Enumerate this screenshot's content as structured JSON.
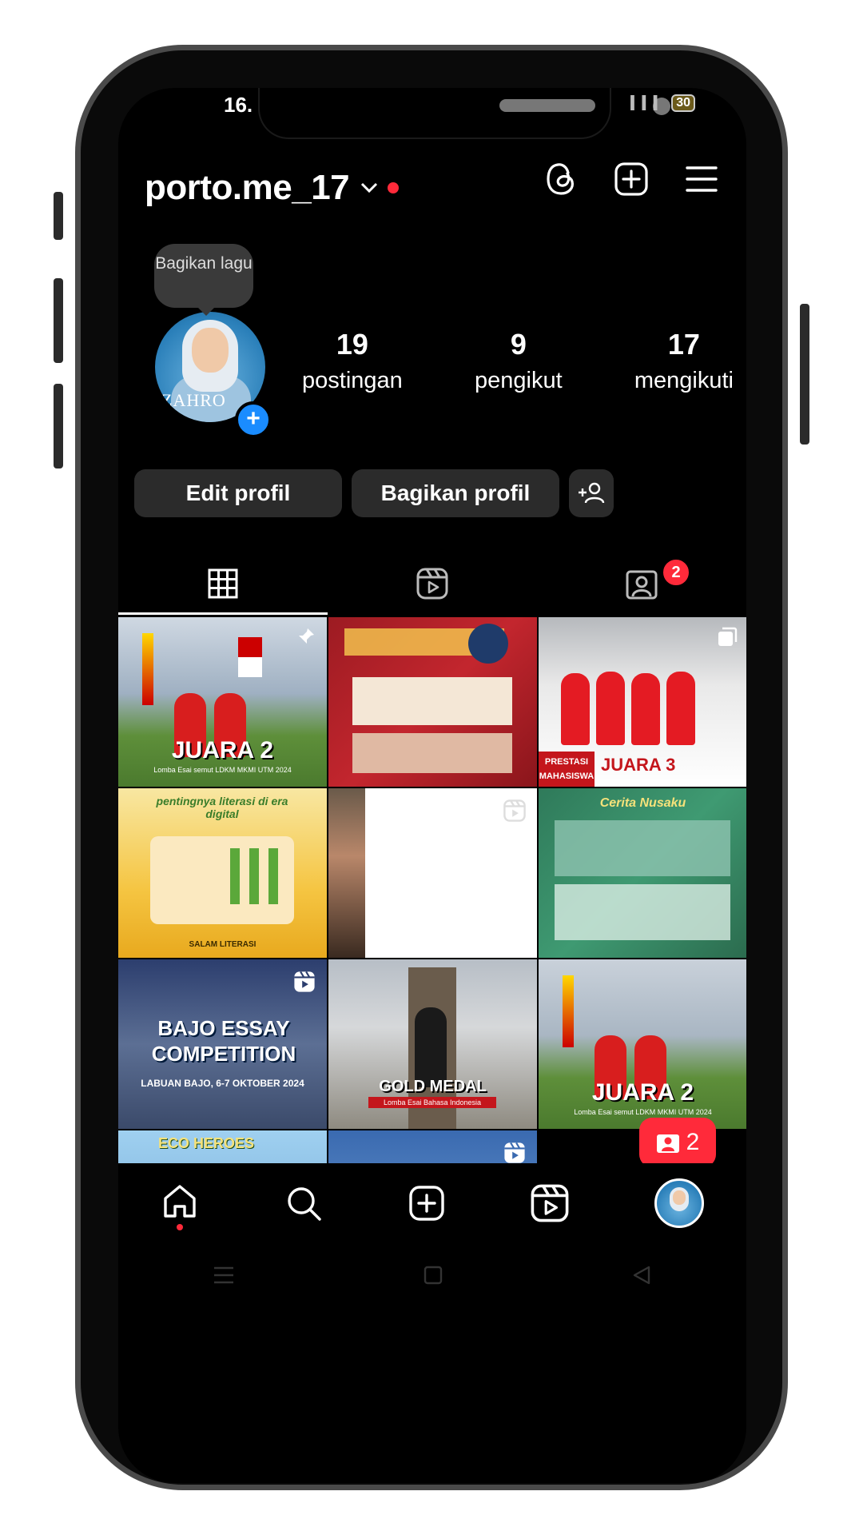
{
  "status_bar": {
    "time": "16.",
    "signal_text": "",
    "battery": "30"
  },
  "header": {
    "username": "porto.me_17",
    "chevron": "⌄"
  },
  "tooltip": {
    "text": "Bagikan lagu"
  },
  "avatar": {
    "name_text": "ZAHRO"
  },
  "stats": [
    {
      "count": "19",
      "label": "postingan"
    },
    {
      "count": "9",
      "label": "pengikut"
    },
    {
      "count": "17",
      "label": "mengikuti"
    }
  ],
  "buttons": {
    "edit": "Edit profil",
    "share": "Bagikan profil"
  },
  "tabs": {
    "tagged_badge": "2",
    "active": "grid"
  },
  "posts": [
    {
      "caption": "JUARA 2",
      "sub": "Lomba Esai semut LDKM MKMI UTM 2024",
      "pinned": true
    },
    {
      "caption": "",
      "sub": "",
      "theme": "red-infographic"
    },
    {
      "caption": "JUARA 3",
      "sub": "PRESTASI MAHASISWA",
      "multi": true
    },
    {
      "caption": "pentingnya literasi di era digital",
      "sub": "SALAM LITERASI",
      "theme": "yellow"
    },
    {
      "caption": "",
      "sub": "",
      "theme": "reel-blank",
      "reel": true
    },
    {
      "caption": "Cerita Nusaku",
      "sub": "",
      "theme": "green-batik"
    },
    {
      "caption": "BAJO ESSAY COMPETITION",
      "sub": "LABUAN BAJO, 6-7 OKTOBER 2024",
      "reel": true
    },
    {
      "caption": "GOLD MEDAL",
      "sub": "Lomba Esai Bahasa Indonesia"
    },
    {
      "caption": "JUARA 2",
      "sub": "Lomba Esai semut LDKM MKMI UTM 2024"
    },
    {
      "caption": "ECO HEROES",
      "sub": ""
    },
    {
      "caption": "",
      "sub": "",
      "reel": true
    },
    {
      "caption": "",
      "sub": ""
    }
  ],
  "notification": {
    "count": "2"
  },
  "colors": {
    "accent_red": "#ff2a3a",
    "accent_blue": "#1a8cff",
    "button_bg": "#2b2b2b"
  }
}
